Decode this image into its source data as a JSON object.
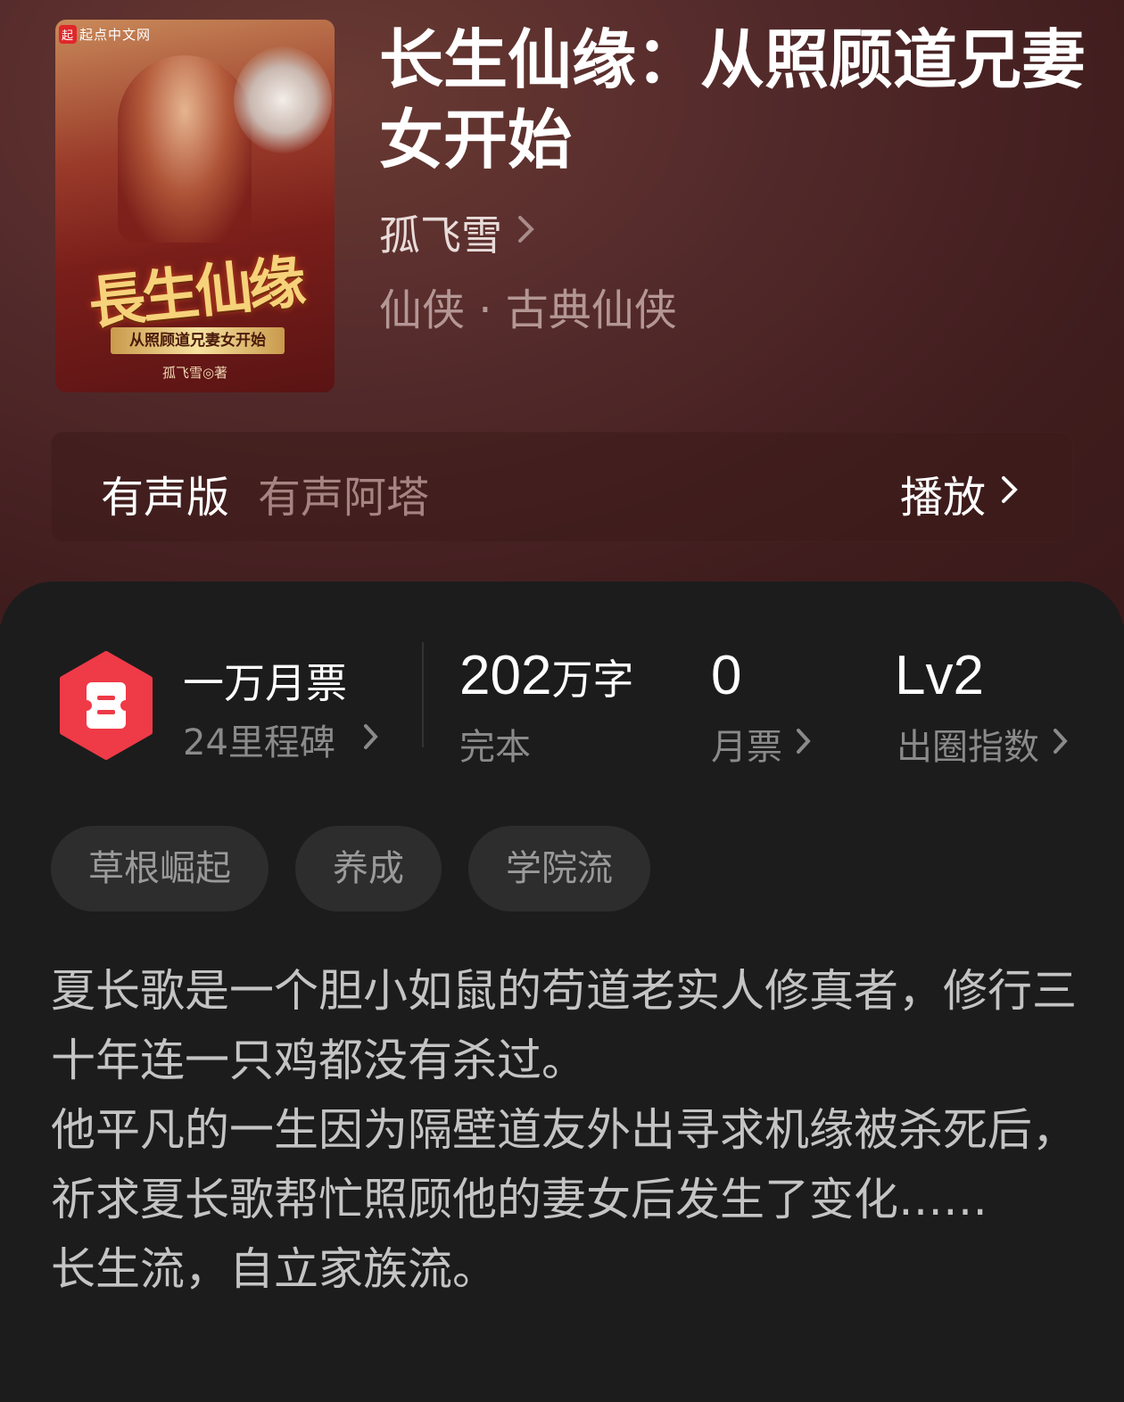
{
  "cover": {
    "logo_badge": "起",
    "logo_text": "起点中文网",
    "title_art": "長生仙缘",
    "subtitle_art": "从照顾道兄妻女开始",
    "author_art": "孤飞雪◎著"
  },
  "book": {
    "title": "长生仙缘：从照顾道兄妻女开始",
    "author": "孤飞雪",
    "genre": "仙侠 · 古典仙侠"
  },
  "audio": {
    "label": "有声版",
    "narrator": "有声阿塔",
    "play_label": "播放"
  },
  "stats": {
    "ticket_title": "一万月票",
    "ticket_sub": "24里程碑",
    "words_number": "202",
    "words_unit": "万字",
    "status": "完本",
    "monthly_value": "0",
    "monthly_label": "月票",
    "level_value": "Lv2",
    "level_label": "出圈指数"
  },
  "tags": [
    "草根崛起",
    "养成",
    "学院流"
  ],
  "description": "夏长歌是一个胆小如鼠的苟道老实人修真者，修行三十年连一只鸡都没有杀过。\n他平凡的一生因为隔壁道友外出寻求机缘被杀死后，祈求夏长歌帮忙照顾他的妻女后发生了变化……\n长生流，自立家族流。",
  "colors": {
    "hero_bg": "#52292a",
    "panel_bg": "#1c1c1c",
    "ticket_red": "#ef3a47"
  },
  "icons": {
    "chevron": "chevron-right-icon",
    "ticket": "monthly-ticket-icon"
  }
}
